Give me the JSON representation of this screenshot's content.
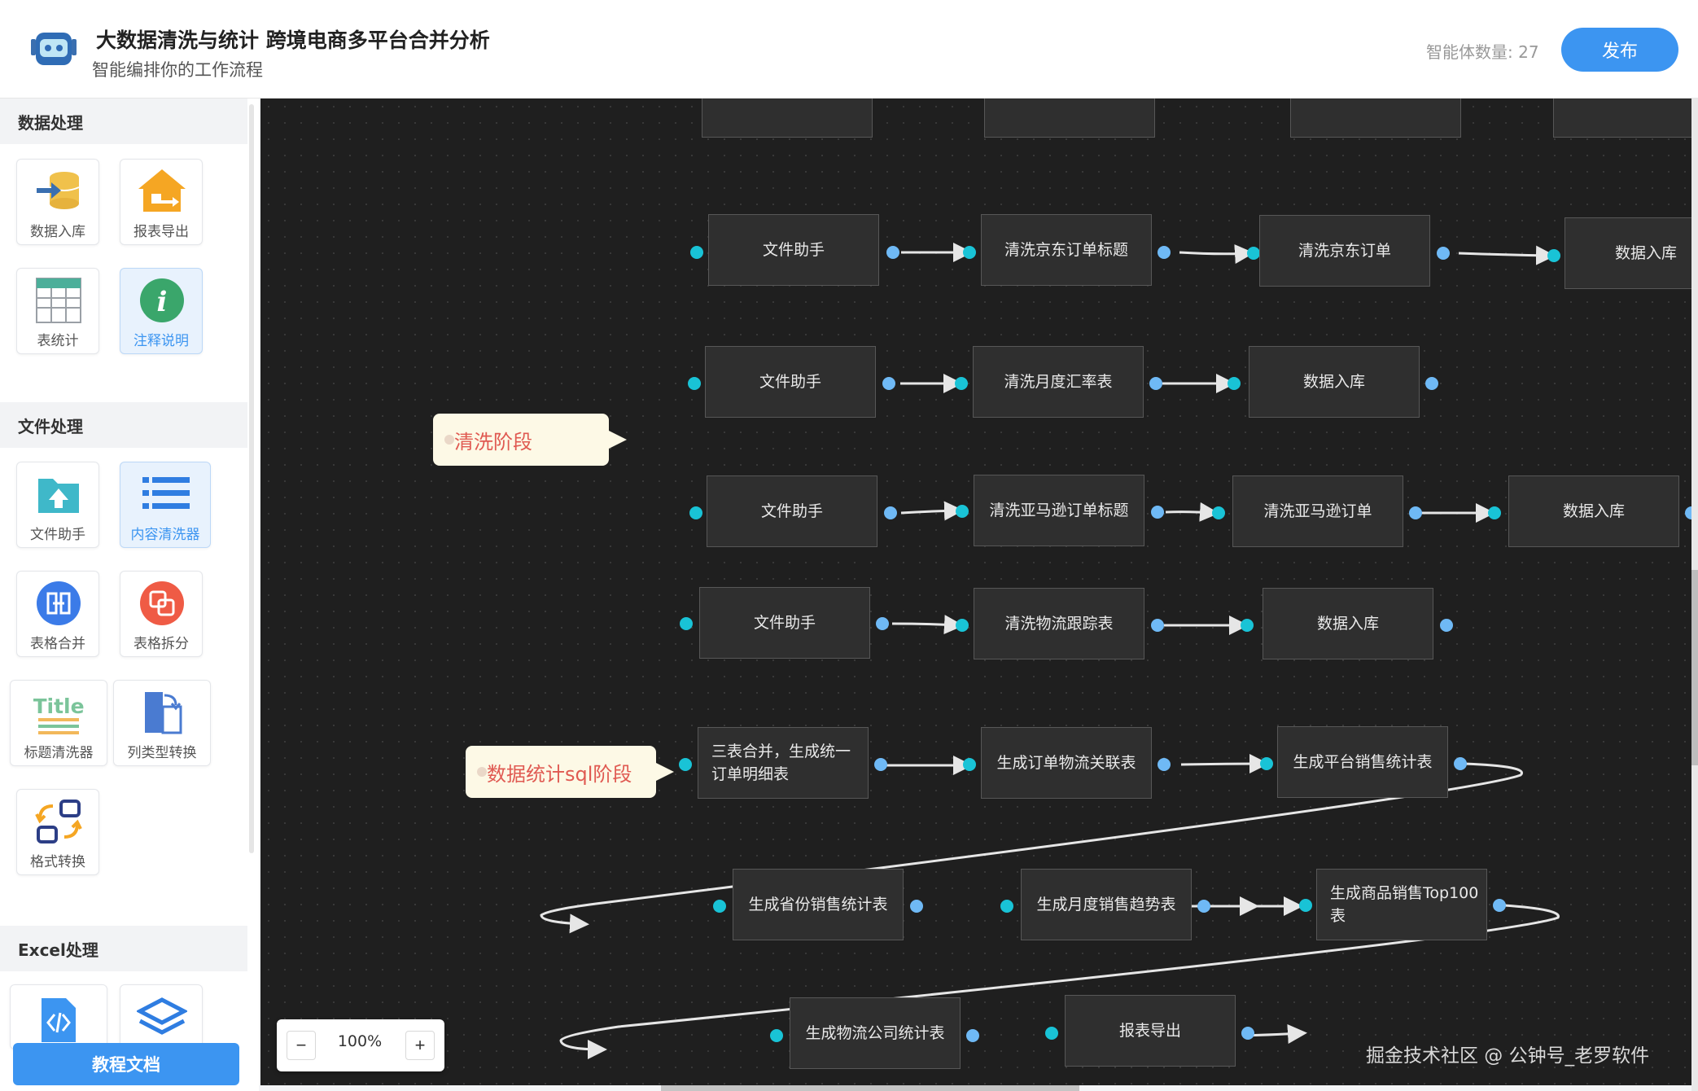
{
  "header": {
    "title": "大数据清洗与统计 跨境电商多平台合并分析",
    "subtitle": "智能编排你的工作流程",
    "agent_count": "智能体数量: 27",
    "publish_label": "发布"
  },
  "sidebar": {
    "sections": {
      "data": "数据处理",
      "file": "文件处理",
      "excel": "Excel处理"
    },
    "tools": {
      "data_import": "数据入库",
      "report_export": "报表导出",
      "table_stats": "表统计",
      "annotation": "注释说明",
      "file_helper": "文件助手",
      "content_cleaner": "内容清洗器",
      "table_merge": "表格合并",
      "table_split": "表格拆分",
      "title_cleaner": "标题清洗器",
      "column_convert": "列类型转换",
      "format_convert": "格式转换"
    },
    "title_icon_text": "Title",
    "tutorial_label": "教程文档"
  },
  "canvas": {
    "notes": {
      "cleaning": "清洗阶段",
      "stats": "数据统计sql阶段"
    },
    "nodes": {
      "r1": [
        "文件助手",
        "清洗京东订单标题",
        "清洗京东订单",
        "数据入库"
      ],
      "r2": [
        "文件助手",
        "清洗月度汇率表",
        "数据入库"
      ],
      "r3": [
        "文件助手",
        "清洗亚马逊订单标题",
        "清洗亚马逊订单",
        "数据入库"
      ],
      "r4": [
        "文件助手",
        "清洗物流跟踪表",
        "数据入库"
      ],
      "r5": [
        "三表合并，生成统一订单明细表",
        "生成订单物流关联表",
        "生成平台销售统计表"
      ],
      "r6": [
        "生成省份销售统计表",
        "生成月度销售趋势表",
        "生成商品销售Top100表"
      ],
      "r7": [
        "生成物流公司统计表",
        "报表导出"
      ]
    },
    "zoom": {
      "minus": "−",
      "value": "100%",
      "plus": "+"
    },
    "watermark": "掘金技术社区 @ 公钟号_老罗软件"
  },
  "colors": {
    "accent": "#3c95f1",
    "canvas_bg": "#1f1f1f",
    "node_bg": "#2f2f2f",
    "port_in": "#19c3d6",
    "port_out": "#6fb9f5",
    "note_text": "#e05a52"
  }
}
